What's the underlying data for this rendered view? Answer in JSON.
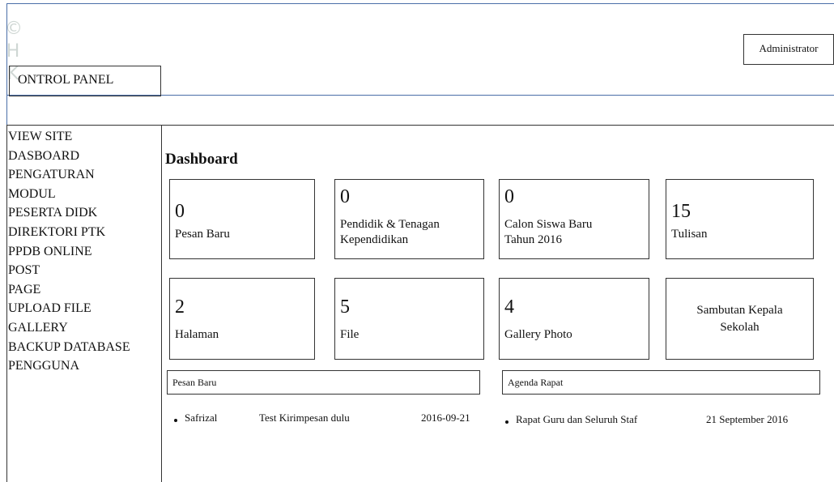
{
  "header": {
    "control_panel_label": "ONTROL PANEL",
    "user_label": "Administrator"
  },
  "watermark": {
    "glyphs": [
      "©",
      "H",
      "K"
    ]
  },
  "sidebar": {
    "items": [
      {
        "label": "VIEW SITE"
      },
      {
        "label": "DASBOARD"
      },
      {
        "label": "PENGATURAN"
      },
      {
        "label": "MODUL"
      },
      {
        "label": "PESERTA DIDK"
      },
      {
        "label": "DIREKTORI PTK"
      },
      {
        "label": "PPDB ONLINE"
      },
      {
        "label": "POST"
      },
      {
        "label": "PAGE"
      },
      {
        "label": "UPLOAD FILE"
      },
      {
        "label": "GALLERY"
      },
      {
        "label": "BACKUP DATABASE"
      },
      {
        "label": "PENGGUNA"
      }
    ]
  },
  "main": {
    "title": "Dashboard",
    "cards": [
      {
        "value": "0",
        "label_lines": [
          "Pesan Baru"
        ]
      },
      {
        "value": "0",
        "label_lines": [
          "Pendidik & Tenagan",
          "Kependidikan"
        ]
      },
      {
        "value": "0",
        "label_lines": [
          "Calon Siswa Baru",
          "Tahun 2016"
        ]
      },
      {
        "value": "15",
        "label_lines": [
          "Tulisan"
        ]
      },
      {
        "value": "2",
        "label_lines": [
          "Halaman"
        ]
      },
      {
        "value": "5",
        "label_lines": [
          "File"
        ]
      },
      {
        "value": "4",
        "label_lines": [
          "Gallery Photo"
        ]
      },
      {
        "value": "",
        "label_lines": [
          "Sambutan Kepala",
          "Sekolah"
        ]
      }
    ],
    "messages_panel": {
      "title": "Pesan Baru",
      "rows": [
        {
          "sender": "Safrizal",
          "message": "Test Kirimpesan dulu",
          "date": "2016-09-21"
        }
      ]
    },
    "agenda_panel": {
      "title": "Agenda Rapat",
      "rows": [
        {
          "title": "Rapat Guru dan Seluruh Staf",
          "date": "21 September 2016"
        }
      ]
    }
  }
}
